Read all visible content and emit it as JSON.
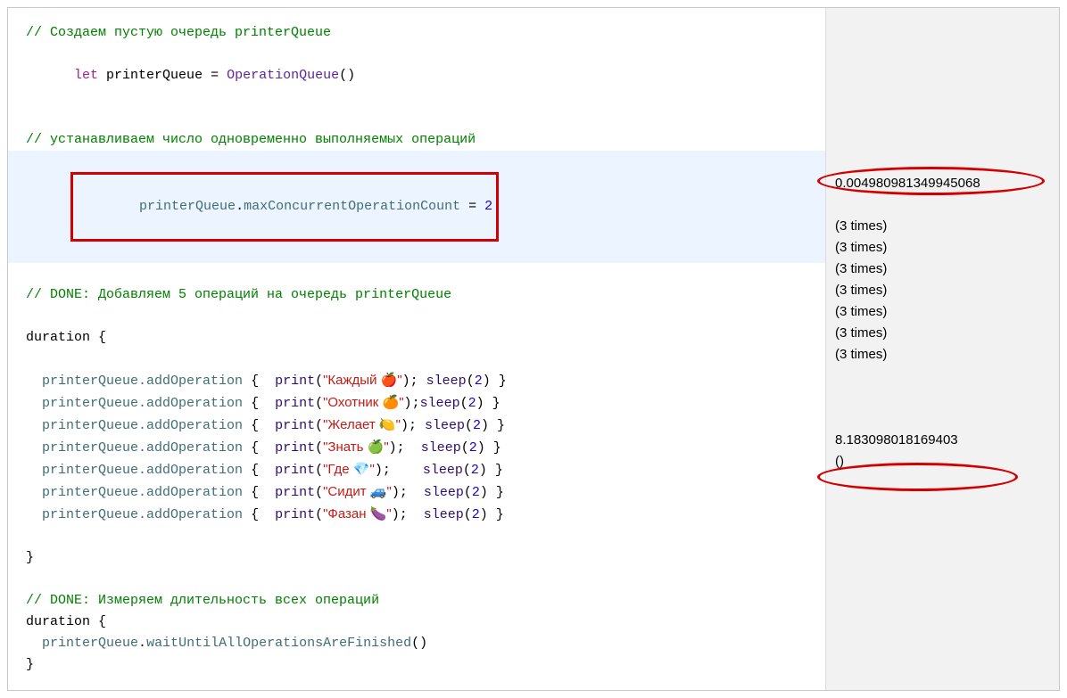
{
  "code": {
    "comment1": "// Создаем пустую очередь printerQueue",
    "let": "let",
    "varName": "printerQueue",
    "assignOp": " = ",
    "typeCtor": "OperationQueue",
    "parens": "()",
    "comment2": "// устанавливаем число одновременно выполняемых операций",
    "maxConcurrent": {
      "obj": "printerQueue",
      "dot": ".",
      "prop": "maxConcurrentOperationCount",
      "eq": " = ",
      "val": "2"
    },
    "comment3": "// DONE: Добавляем 5 операций на очередь printerQueue",
    "durationOpen": "duration {",
    "ops": [
      {
        "prefix": "  printerQueue",
        "method": ".addOperation",
        "open": " {  ",
        "print": "print",
        "lpar": "(",
        "str": "\"Каждый 🍎\"",
        "rpar": ")",
        "sep": "; ",
        "sleep": "sleep",
        "slpar": "(",
        "sval": "2",
        "srpar": ")",
        "close": " }"
      },
      {
        "prefix": "  printerQueue",
        "method": ".addOperation",
        "open": " {  ",
        "print": "print",
        "lpar": "(",
        "str": "\"Охотник 🍊\"",
        "rpar": ")",
        "sep": ";",
        "sleep": "sleep",
        "slpar": "(",
        "sval": "2",
        "srpar": ")",
        "close": " }"
      },
      {
        "prefix": "  printerQueue",
        "method": ".addOperation",
        "open": " {  ",
        "print": "print",
        "lpar": "(",
        "str": "\"Желает 🍋\"",
        "rpar": ")",
        "sep": "; ",
        "sleep": "sleep",
        "slpar": "(",
        "sval": "2",
        "srpar": ")",
        "close": " }"
      },
      {
        "prefix": "  printerQueue",
        "method": ".addOperation",
        "open": " {  ",
        "print": "print",
        "lpar": "(",
        "str": "\"Знать 🍏\"",
        "rpar": ")",
        "sep": ";  ",
        "sleep": "sleep",
        "slpar": "(",
        "sval": "2",
        "srpar": ")",
        "close": " }"
      },
      {
        "prefix": "  printerQueue",
        "method": ".addOperation",
        "open": " {  ",
        "print": "print",
        "lpar": "(",
        "str": "\"Где 💎\"",
        "rpar": ")",
        "sep": ";    ",
        "sleep": "sleep",
        "slpar": "(",
        "sval": "2",
        "srpar": ")",
        "close": " }"
      },
      {
        "prefix": "  printerQueue",
        "method": ".addOperation",
        "open": " {  ",
        "print": "print",
        "lpar": "(",
        "str": "\"Сидит 🚙\"",
        "rpar": ")",
        "sep": ";  ",
        "sleep": "sleep",
        "slpar": "(",
        "sval": "2",
        "srpar": ")",
        "close": " }"
      },
      {
        "prefix": "  printerQueue",
        "method": ".addOperation",
        "open": " {  ",
        "print": "print",
        "lpar": "(",
        "str": "\"Фазан 🍆\"",
        "rpar": ")",
        "sep": ";  ",
        "sleep": "sleep",
        "slpar": "(",
        "sval": "2",
        "srpar": ")",
        "close": " }"
      }
    ],
    "durationClose": "}",
    "comment4": "// DONE: Измеряем длительность всех операций",
    "durationOpen2": "duration {",
    "wait": {
      "indent": "  ",
      "obj": "printerQueue",
      "dot": ".",
      "method": "waitUntilAllOperationsAreFinished",
      "parens": "()"
    },
    "durationClose2": "}"
  },
  "results": {
    "value1": "0.004980981349945068",
    "times": "(3 times)",
    "value2": "8.183098018169403",
    "unit": "()"
  }
}
